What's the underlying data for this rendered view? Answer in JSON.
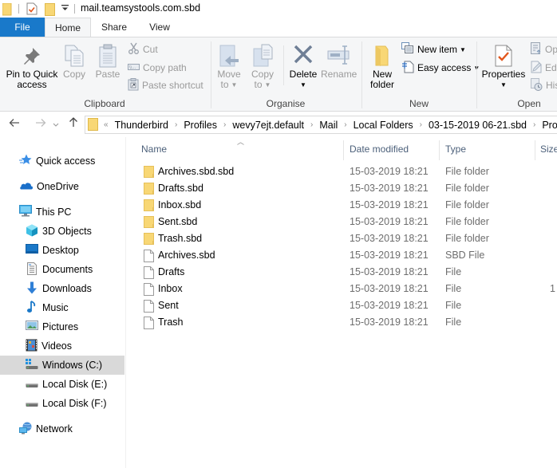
{
  "window": {
    "title": "mail.teamsystools.com.sbd"
  },
  "tabs": [
    {
      "label": "File"
    },
    {
      "label": "Home"
    },
    {
      "label": "Share"
    },
    {
      "label": "View"
    }
  ],
  "ribbon": {
    "clipboard": {
      "group_label": "Clipboard",
      "pin_label_1": "Pin to Quick",
      "pin_label_2": "access",
      "copy": "Copy",
      "paste": "Paste",
      "cut": "Cut",
      "copy_path": "Copy path",
      "paste_shortcut": "Paste shortcut"
    },
    "organise": {
      "group_label": "Organise",
      "move_to_1": "Move",
      "move_to_2": "to",
      "copy_to_1": "Copy",
      "copy_to_2": "to",
      "delete": "Delete",
      "rename": "Rename"
    },
    "new": {
      "group_label": "New",
      "new_folder_1": "New",
      "new_folder_2": "folder",
      "new_item": "New item",
      "easy_access": "Easy access"
    },
    "open": {
      "group_label": "Open",
      "properties": "Properties",
      "open": "Op",
      "edit": "Edi",
      "history": "His"
    }
  },
  "address": {
    "overflow": "«",
    "crumbs": [
      "Thunderbird",
      "Profiles",
      "wevy7ejt.default",
      "Mail",
      "Local Folders",
      "03-15-2019 06-21.sbd",
      "Pro"
    ]
  },
  "sidebar": {
    "items": [
      {
        "label": "Quick access",
        "icon": "star-icon"
      },
      {
        "label": "OneDrive",
        "icon": "cloud-icon"
      },
      {
        "label": "This PC",
        "icon": "computer-icon"
      },
      {
        "label": "3D Objects",
        "icon": "cube-icon"
      },
      {
        "label": "Desktop",
        "icon": "desktop-icon"
      },
      {
        "label": "Documents",
        "icon": "document-icon"
      },
      {
        "label": "Downloads",
        "icon": "download-icon"
      },
      {
        "label": "Music",
        "icon": "music-icon"
      },
      {
        "label": "Pictures",
        "icon": "picture-icon"
      },
      {
        "label": "Videos",
        "icon": "video-icon"
      },
      {
        "label": "Windows (C:)",
        "icon": "drive-icon",
        "selected": true
      },
      {
        "label": "Local Disk (E:)",
        "icon": "drive-icon"
      },
      {
        "label": "Local Disk (F:)",
        "icon": "drive-icon"
      },
      {
        "label": "Network",
        "icon": "network-icon"
      }
    ]
  },
  "filelist": {
    "columns": {
      "name": "Name",
      "date": "Date modified",
      "type": "Type",
      "size": "Size"
    },
    "rows": [
      {
        "name": "Archives.sbd.sbd",
        "date": "15-03-2019 18:21",
        "type": "File folder",
        "size": "",
        "kind": "folder"
      },
      {
        "name": "Drafts.sbd",
        "date": "15-03-2019 18:21",
        "type": "File folder",
        "size": "",
        "kind": "folder"
      },
      {
        "name": "Inbox.sbd",
        "date": "15-03-2019 18:21",
        "type": "File folder",
        "size": "",
        "kind": "folder"
      },
      {
        "name": "Sent.sbd",
        "date": "15-03-2019 18:21",
        "type": "File folder",
        "size": "",
        "kind": "folder"
      },
      {
        "name": "Trash.sbd",
        "date": "15-03-2019 18:21",
        "type": "File folder",
        "size": "",
        "kind": "folder"
      },
      {
        "name": "Archives.sbd",
        "date": "15-03-2019 18:21",
        "type": "SBD File",
        "size": "",
        "kind": "file"
      },
      {
        "name": "Drafts",
        "date": "15-03-2019 18:21",
        "type": "File",
        "size": "",
        "kind": "file"
      },
      {
        "name": "Inbox",
        "date": "15-03-2019 18:21",
        "type": "File",
        "size": "1",
        "kind": "file"
      },
      {
        "name": "Sent",
        "date": "15-03-2019 18:21",
        "type": "File",
        "size": "",
        "kind": "file"
      },
      {
        "name": "Trash",
        "date": "15-03-2019 18:21",
        "type": "File",
        "size": "",
        "kind": "file"
      }
    ]
  },
  "colors": {
    "file_tab": "#1979ca",
    "folder_yellow": "#f8d775",
    "selected_bg": "#d9d9d9",
    "header_text": "#4c607a"
  }
}
